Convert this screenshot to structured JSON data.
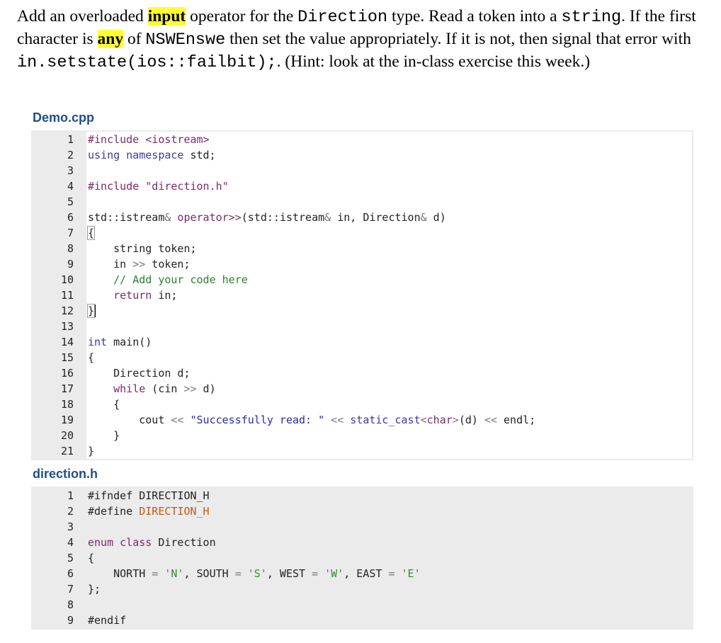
{
  "instructions": {
    "p1": "Add an overloaded ",
    "hl1": "input",
    "p2": " operator for the ",
    "m1": "Direction",
    "p3": " type. Read a token into a ",
    "m2": "string",
    "p4": ". If the first character is ",
    "hl2": "any",
    "p5": " of ",
    "m3": "NSWEnswe",
    "p6": " then set the value appropriately. If it is not, then signal that error with ",
    "m4": "in.setstate(ios::failbit);",
    "p7": ". (Hint: look at the in-class exercise this week.)"
  },
  "demo": {
    "title": "Demo.cpp",
    "line_numbers": [
      "1",
      "2",
      "3",
      "4",
      "5",
      "6",
      "7",
      "8",
      "9",
      "10",
      "11",
      "12",
      "13",
      "14",
      "15",
      "16",
      "17",
      "18",
      "19",
      "20",
      "21"
    ],
    "lines": {
      "l1": "#include <iostream>",
      "l2a": "using namespace",
      "l2b": " std;",
      "l4": "#include \"direction.h\"",
      "l6a": "std::istream",
      "l6b": "&",
      "l6c": " operator>>",
      "l6d": "(std::istream",
      "l6e": "&",
      "l6f": " in, Direction",
      "l6g": "&",
      "l6h": " d)",
      "l7": "{",
      "l8": "    string token;",
      "l9a": "    in ",
      "l9b": ">>",
      "l9c": " token;",
      "l10": "    // Add your code here",
      "l11a": "    return",
      "l11b": " in;",
      "l12": "}",
      "l14a": "int",
      "l14b": " main()",
      "l15": "{",
      "l16": "    Direction d;",
      "l17a": "    while",
      "l17b": " (cin ",
      "l17c": ">>",
      "l17d": " d)",
      "l18": "    {",
      "l19a": "        cout ",
      "l19b": "<<",
      "l19c": " \"Successfully read: \"",
      "l19d": " << ",
      "l19e": "static_cast",
      "l19f": "<",
      "l19g": "char",
      "l19h": ">",
      "l19i": "(d) ",
      "l19j": "<<",
      "l19k": " endl;",
      "l20": "    }",
      "l21": "}"
    }
  },
  "header": {
    "title": "direction.h",
    "line_numbers": [
      "1",
      "2",
      "3",
      "4",
      "5",
      "6",
      "7",
      "8",
      "9"
    ],
    "lines": {
      "l1": "#ifndef DIRECTION_H",
      "l2a": "#define ",
      "l2b": "DIRECTION_H",
      "l4a": "enum class",
      "l4b": " Direction",
      "l5": "{",
      "l6a": "    NORTH ",
      "l6b": "=",
      "l6c": " 'N'",
      "l6d": ", SOUTH ",
      "l6e": "=",
      "l6f": " 'S'",
      "l6g": ", WEST ",
      "l6h": "=",
      "l6i": " 'W'",
      "l6j": ", EAST ",
      "l6k": "=",
      "l6l": " 'E'",
      "l7": "};",
      "l9": "#endif"
    }
  }
}
